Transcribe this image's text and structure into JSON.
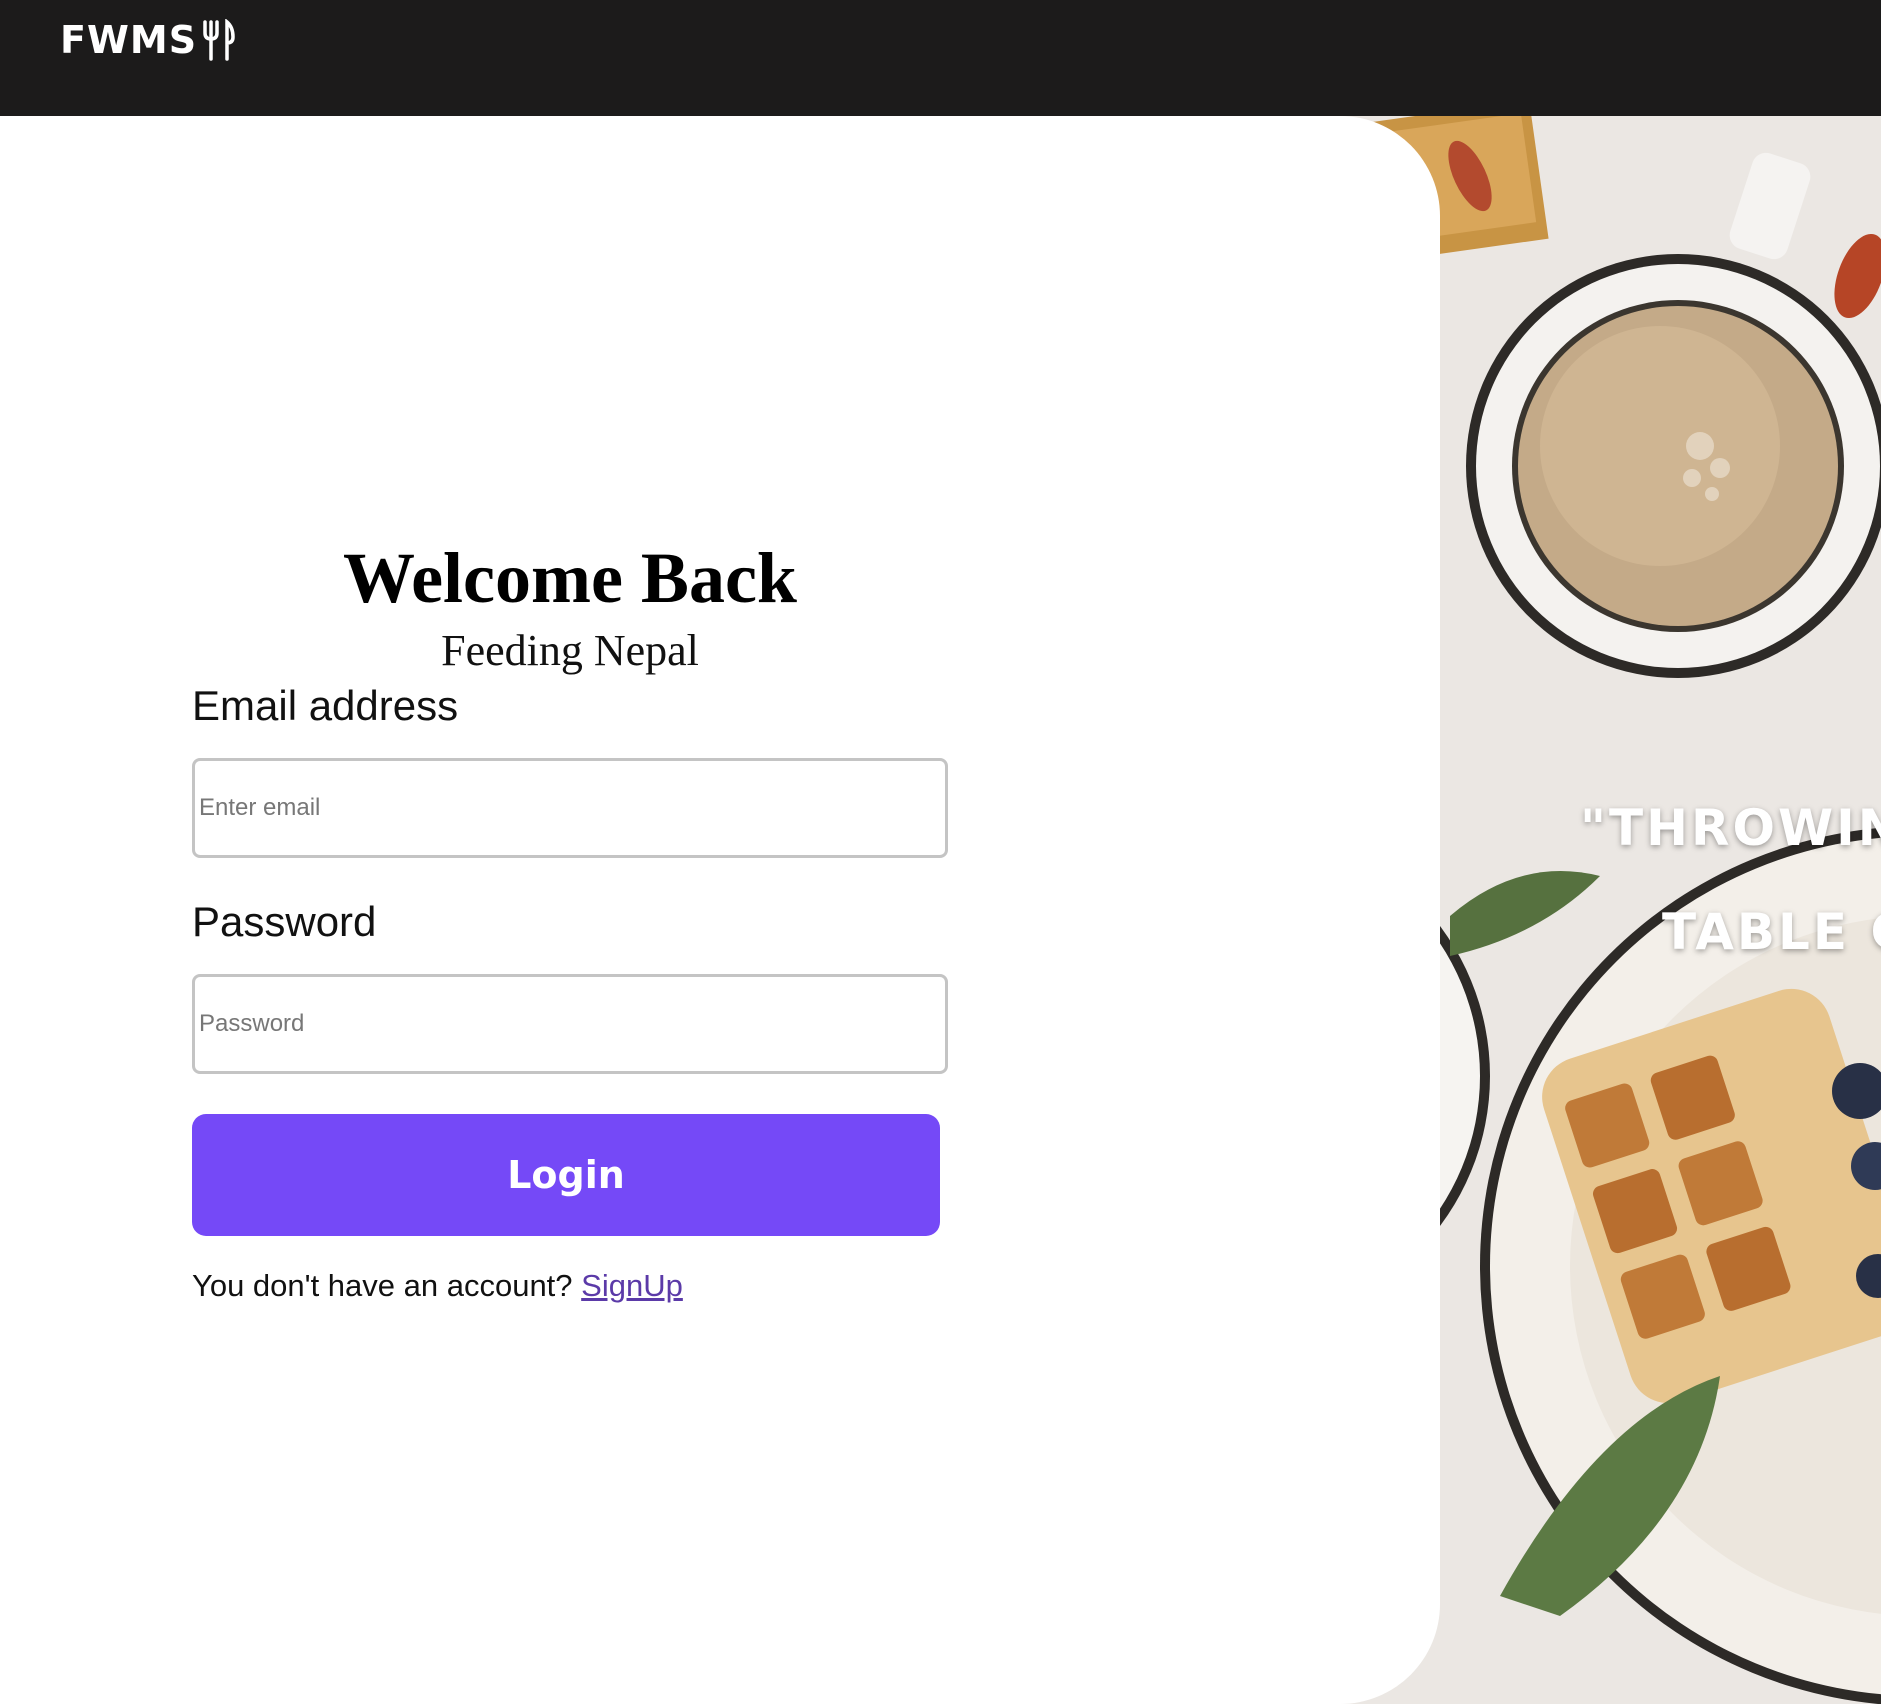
{
  "navbar": {
    "brand": "FWMS",
    "brand_icon": "fork-knife-icon",
    "background": "#1c1b1b"
  },
  "login": {
    "title": "Welcome Back",
    "subtitle": "Feeding Nepal",
    "email_label": "Email address",
    "email_placeholder": "Enter email",
    "email_value": "",
    "password_label": "Password",
    "password_placeholder": "Password",
    "password_value": "",
    "login_button": "Login",
    "signup_prompt": "You don't have an account?",
    "signup_link": "SignUp",
    "accent_color": "#7549f7"
  },
  "hero": {
    "line1": "\"THROWIN",
    "line2": "TABLE C"
  }
}
